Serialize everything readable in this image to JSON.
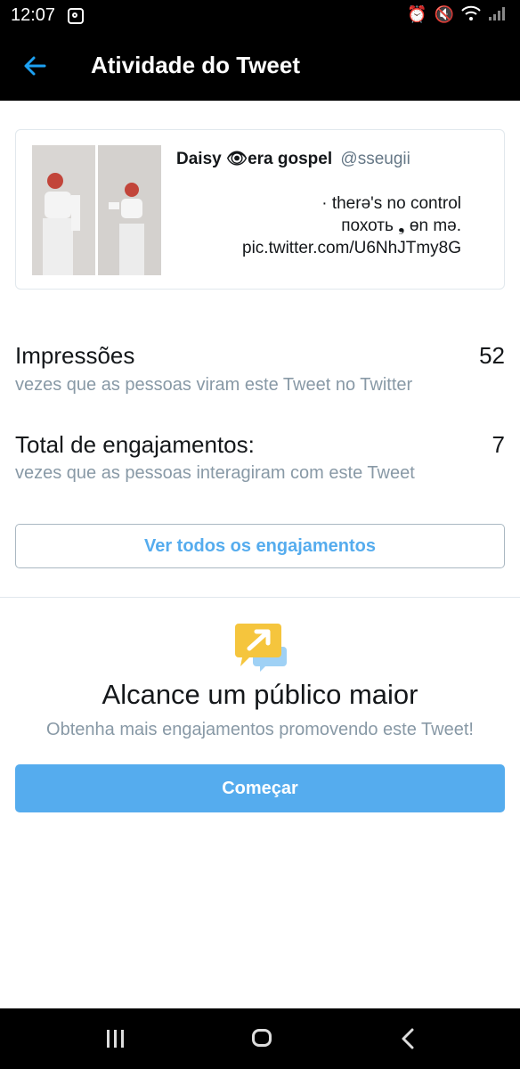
{
  "status_bar": {
    "time": "12:07"
  },
  "header": {
    "title": "Atividade do Tweet"
  },
  "tweet": {
    "name": "Daisy 👁era gospel",
    "handle": "@sseugii",
    "text": "· therə's no control\nпохоть ❟ ɵn mə.\npic.twitter.com/U6NhJTmy8G"
  },
  "stats": [
    {
      "label": "Impressões",
      "value": "52",
      "description": "vezes que as pessoas viram este Tweet no Twitter"
    },
    {
      "label": "Total de engajamentos:",
      "value": "7",
      "description": "vezes que as pessoas interagiram com este Tweet"
    }
  ],
  "view_all_button": "Ver todos os engajamentos",
  "promo": {
    "title": "Alcance um público maior",
    "subtitle": "Obtenha mais engajamentos promovendo este Tweet!",
    "button": "Começar"
  },
  "colors": {
    "accent": "#55acee",
    "muted": "#8899a6",
    "promo_yellow": "#f5c53d",
    "promo_blue": "#9fd1f5"
  },
  "icons": {
    "back": "arrow-left-icon",
    "instagram": "instagram-icon",
    "alarm": "alarm-icon",
    "mute": "mute-icon",
    "wifi": "wifi-icon",
    "signal": "signal-icon",
    "promote": "promote-arrow-icon",
    "recents": "recents-icon",
    "home": "home-icon",
    "nav_back": "chevron-left-icon"
  }
}
